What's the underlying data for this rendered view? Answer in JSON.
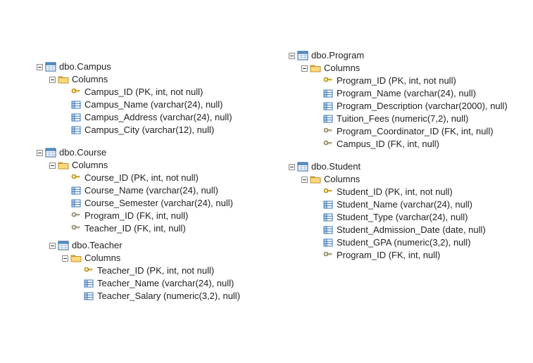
{
  "left": {
    "tables": [
      {
        "name": "dbo.Campus",
        "columns_label": "Columns",
        "columns": [
          {
            "icon": "pk",
            "text": "Campus_ID (PK, int, not null)"
          },
          {
            "icon": "col",
            "text": "Campus_Name (varchar(24), null)"
          },
          {
            "icon": "col",
            "text": "Campus_Address (varchar(24), null)"
          },
          {
            "icon": "col",
            "text": "Campus_City (varchar(12), null)"
          }
        ]
      },
      {
        "name": "dbo.Course",
        "columns_label": "Columns",
        "columns": [
          {
            "icon": "pk",
            "text": "Course_ID (PK, int, not null)"
          },
          {
            "icon": "col",
            "text": "Course_Name (varchar(24), null)"
          },
          {
            "icon": "col",
            "text": "Course_Semester (varchar(24), null)"
          },
          {
            "icon": "fk",
            "text": "Program_ID (FK, int, null)"
          },
          {
            "icon": "fk",
            "text": "Teacher_ID (FK, int, null)"
          }
        ],
        "subtables": [
          {
            "name": "dbo.Teacher",
            "columns_label": "Columns",
            "columns": [
              {
                "icon": "pk",
                "text": "Teacher_ID (PK, int, not null)"
              },
              {
                "icon": "col",
                "text": "Teacher_Name (varchar(24), null)"
              },
              {
                "icon": "col",
                "text": "Teacher_Salary (numeric(3,2), null)"
              }
            ]
          }
        ]
      }
    ]
  },
  "right": {
    "tables": [
      {
        "name": "dbo.Program",
        "columns_label": "Columns",
        "columns": [
          {
            "icon": "pk",
            "text": "Program_ID (PK, int, not null)"
          },
          {
            "icon": "col",
            "text": "Program_Name (varchar(24), null)"
          },
          {
            "icon": "col",
            "text": "Program_Description (varchar(2000), null)"
          },
          {
            "icon": "col",
            "text": "Tuition_Fees (numeric(7,2), null)"
          },
          {
            "icon": "fk",
            "text": "Program_Coordinator_ID (FK, int, null)"
          },
          {
            "icon": "fk",
            "text": "Campus_ID (FK, int, null)"
          }
        ]
      },
      {
        "name": "dbo.Student",
        "columns_label": "Columns",
        "columns": [
          {
            "icon": "pk",
            "text": "Student_ID (PK, int, not null)"
          },
          {
            "icon": "col",
            "text": "Student_Name (varchar(24), null)"
          },
          {
            "icon": "col",
            "text": "Student_Type (varchar(24), null)"
          },
          {
            "icon": "col",
            "text": "Student_Admission_Date (date, null)"
          },
          {
            "icon": "col",
            "text": "Student_GPA (numeric(3,2), null)"
          },
          {
            "icon": "fk",
            "text": "Program_ID (FK, int, null)"
          }
        ]
      }
    ]
  }
}
